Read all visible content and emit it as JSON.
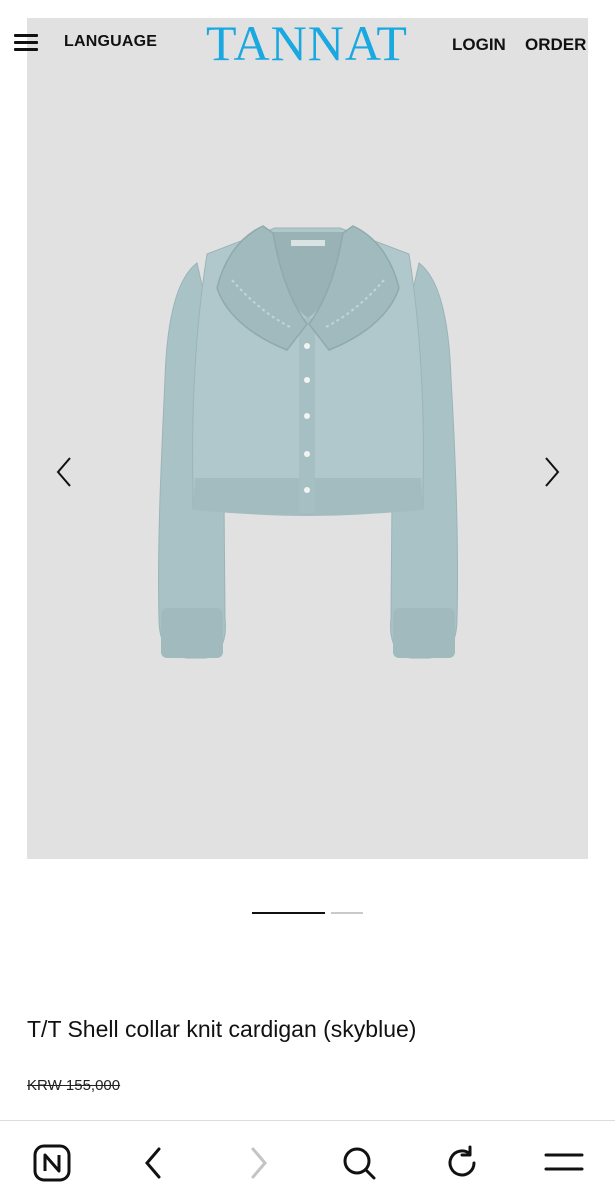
{
  "header": {
    "language_label": "LANGUAGE",
    "logo_text": "TANNAT",
    "login_label": "LOGIN",
    "order_label": "ORDER",
    "logo_color": "#19a8e0"
  },
  "gallery": {
    "background_color": "#e1e1e1",
    "garment_color": "#a9c2c6",
    "slide_count": 2,
    "active_slide": 1
  },
  "product": {
    "title": "T/T Shell collar knit cardigan (skyblue)",
    "original_price": "KRW 155,000"
  },
  "browser_nav": {
    "items": [
      "naver-home-icon",
      "back-icon",
      "forward-icon",
      "search-icon",
      "refresh-icon",
      "menu-icon"
    ]
  }
}
